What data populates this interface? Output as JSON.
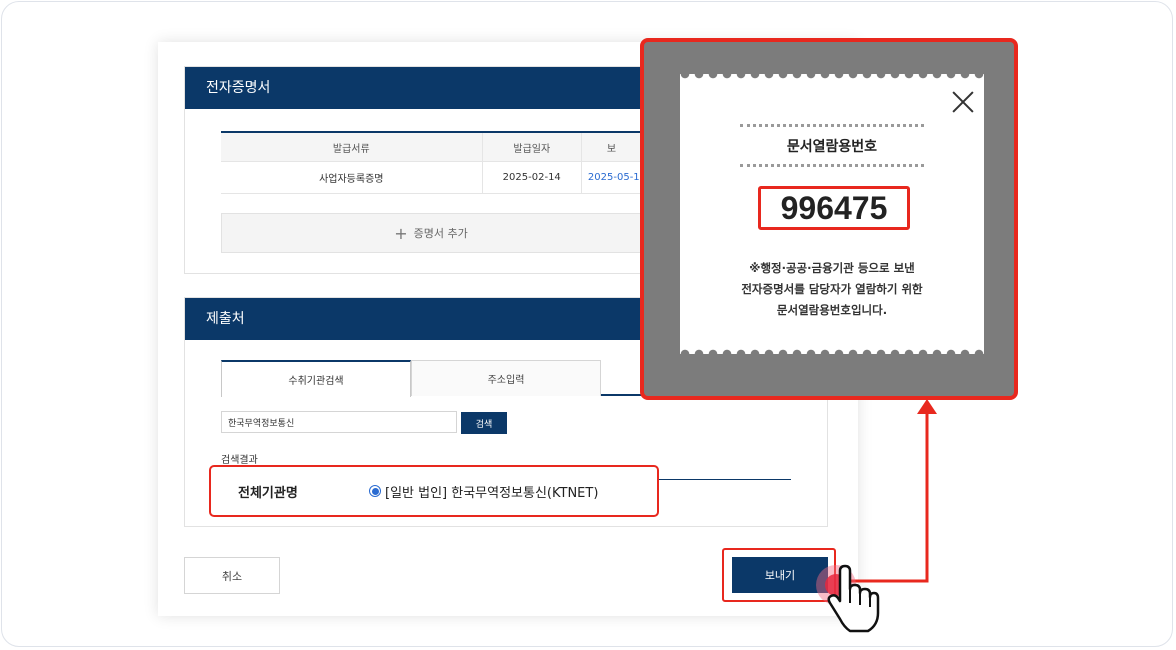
{
  "certificate_section": {
    "title": "전자증명서",
    "table": {
      "headers": [
        "발급서류",
        "발급일자",
        "보"
      ],
      "rows": [
        [
          "사업자등록증명",
          "2025-02-14",
          "2025-05-1"
        ]
      ]
    },
    "add_label": "증명서 추가"
  },
  "submission_section": {
    "title": "제출처",
    "tabs": [
      "수취기관검색",
      "주소입력"
    ],
    "search": {
      "value": "한국무역정보통신",
      "button": "검색"
    },
    "result_label": "검색결과",
    "result": {
      "org_label": "전체기관명",
      "option": "[일반 법인] 한국무역정보통신(KTNET)"
    }
  },
  "footer": {
    "cancel": "취소",
    "send": "보내기"
  },
  "popup": {
    "title": "문서열람용번호",
    "code": "996475",
    "description_lines": [
      "※행정·공공·금융기관 등으로 보낸",
      "전자증명서를 담당자가 열람하기 위한",
      "문서열람용번호입니다."
    ]
  },
  "colors": {
    "primary": "#0b3868",
    "highlight": "#e8281e",
    "link": "#2a6bd1"
  }
}
